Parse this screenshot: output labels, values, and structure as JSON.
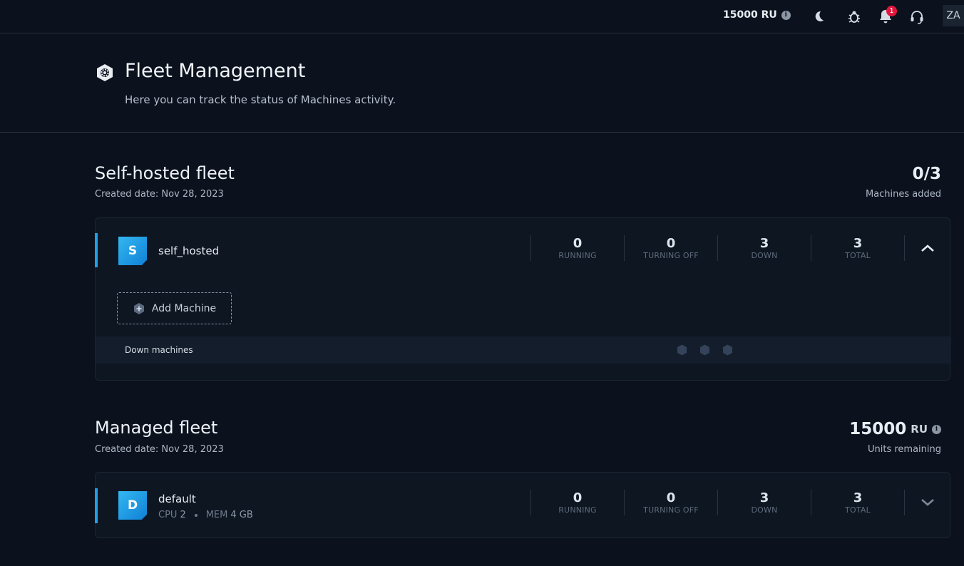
{
  "topbar": {
    "credits_value": "15000 RU",
    "info_glyph": "i",
    "notification_count": "1",
    "avatar_initials": "ZA",
    "icons": [
      "moon-icon",
      "bug-icon",
      "bell-icon",
      "headset-icon"
    ]
  },
  "header": {
    "title": "Fleet Management",
    "subtitle": "Here you can track the status of Machines activity."
  },
  "self_hosted": {
    "section_title": "Self-hosted fleet",
    "created": "Created date: Nov 28, 2023",
    "machines_stat": "0/3",
    "machines_stat_label": "Machines added",
    "fleet": {
      "initial": "S",
      "name": "self_hosted",
      "counts": [
        {
          "value": "0",
          "label": "RUNNING"
        },
        {
          "value": "0",
          "label": "TURNING OFF"
        },
        {
          "value": "3",
          "label": "DOWN"
        },
        {
          "value": "3",
          "label": "TOTAL"
        }
      ],
      "add_machine_label": "Add Machine",
      "down_machines_label": "Down machines"
    }
  },
  "managed": {
    "section_title": "Managed fleet",
    "created": "Created date: Nov 28, 2023",
    "units_value": "15000",
    "units_unit": "RU",
    "units_label": "Units remaining",
    "fleet": {
      "initial": "D",
      "name": "default",
      "cpu_label": "CPU",
      "cpu_value": "2",
      "mem_label": "MEM",
      "mem_value": "4 GB",
      "counts": [
        {
          "value": "0",
          "label": "RUNNING"
        },
        {
          "value": "0",
          "label": "TURNING OFF"
        },
        {
          "value": "3",
          "label": "DOWN"
        },
        {
          "value": "3",
          "label": "TOTAL"
        }
      ]
    }
  },
  "colors": {
    "accent": "#1ea0ea",
    "background": "#0b121d",
    "badge": "#e3173e"
  }
}
